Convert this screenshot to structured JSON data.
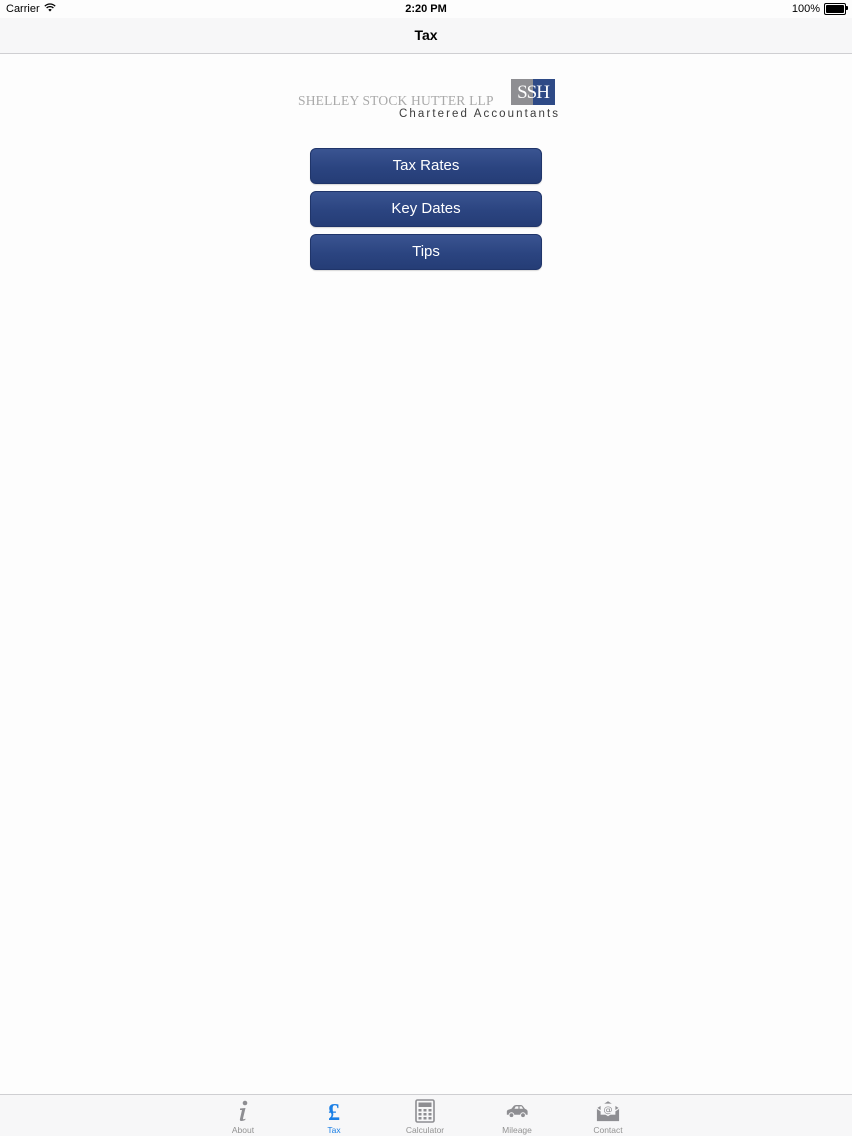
{
  "status_bar": {
    "carrier": "Carrier",
    "time": "2:20 PM",
    "battery_percent": "100%",
    "battery_level": 1.0
  },
  "nav": {
    "title": "Tax"
  },
  "logo": {
    "firm_name": "SHELLEY STOCK HUTTER LLP",
    "monogram": "SSH",
    "subtitle": "Chartered Accountants"
  },
  "menu": {
    "items": [
      {
        "label": "Tax Rates"
      },
      {
        "label": "Key Dates"
      },
      {
        "label": "Tips"
      }
    ]
  },
  "tab_bar": {
    "active_tab": "Tax",
    "active_color": "#1a7fe6",
    "inactive_color": "#929292",
    "tabs": [
      {
        "label": "About",
        "icon": "info-icon"
      },
      {
        "label": "Tax",
        "icon": "pound-sign-icon"
      },
      {
        "label": "Calculator",
        "icon": "calculator-icon"
      },
      {
        "label": "Mileage",
        "icon": "car-icon"
      },
      {
        "label": "Contact",
        "icon": "envelope-at-icon"
      }
    ]
  },
  "colors": {
    "button_blue": "#2b4480",
    "logo_blue": "#2e4a86",
    "logo_grey": "#8e8e92"
  }
}
